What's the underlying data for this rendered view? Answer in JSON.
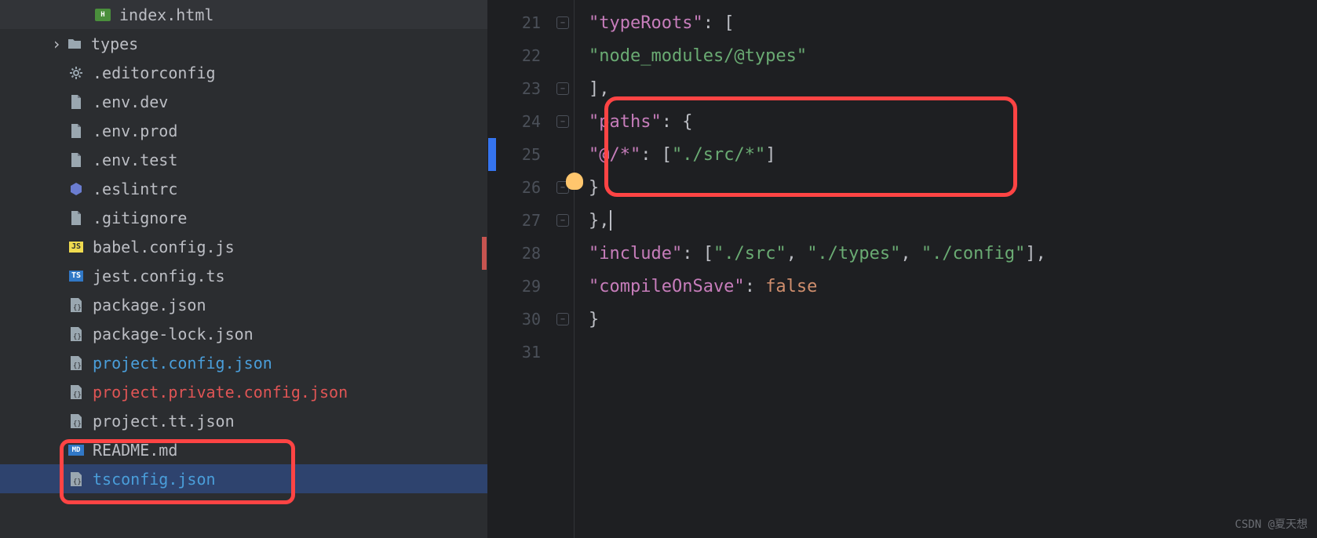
{
  "sidebar": {
    "items": [
      {
        "name": "index.html",
        "icon": "html",
        "indent": 2
      },
      {
        "name": "types",
        "icon": "folder",
        "indent": 0,
        "chevron": true
      },
      {
        "name": ".editorconfig",
        "icon": "gear",
        "indent": 1
      },
      {
        "name": ".env.dev",
        "icon": "file",
        "indent": 1
      },
      {
        "name": ".env.prod",
        "icon": "file",
        "indent": 1
      },
      {
        "name": ".env.test",
        "icon": "file",
        "indent": 1
      },
      {
        "name": ".eslintrc",
        "icon": "eslint",
        "indent": 1
      },
      {
        "name": ".gitignore",
        "icon": "file",
        "indent": 1
      },
      {
        "name": "babel.config.js",
        "icon": "js",
        "indent": 1
      },
      {
        "name": "jest.config.ts",
        "icon": "ts",
        "indent": 1
      },
      {
        "name": "package.json",
        "icon": "json",
        "indent": 1
      },
      {
        "name": "package-lock.json",
        "icon": "json",
        "indent": 1
      },
      {
        "name": "project.config.json",
        "icon": "json",
        "indent": 1,
        "status": "modified"
      },
      {
        "name": "project.private.config.json",
        "icon": "json",
        "indent": 1,
        "status": "error"
      },
      {
        "name": "project.tt.json",
        "icon": "json",
        "indent": 1
      },
      {
        "name": "README.md",
        "icon": "md",
        "indent": 1
      },
      {
        "name": "tsconfig.json",
        "icon": "json",
        "indent": 1,
        "status": "modified",
        "selected": true
      }
    ]
  },
  "editor": {
    "line_numbers": [
      21,
      22,
      23,
      24,
      25,
      26,
      27,
      28,
      29,
      30,
      31
    ],
    "tokens": {
      "l21_key": "\"typeRoots\"",
      "l22_str": "\"node_modules/@types\"",
      "l24_key": "\"paths\"",
      "l25_key": "\"@/*\"",
      "l25_str": "\"./src/*\"",
      "l28_key": "\"include\"",
      "l28_s1": "\"./src\"",
      "l28_s2": "\"./types\"",
      "l28_s3": "\"./config\"",
      "l29_key": "\"compileOnSave\"",
      "l29_bool": "false"
    }
  },
  "watermark": "CSDN @夏天想"
}
